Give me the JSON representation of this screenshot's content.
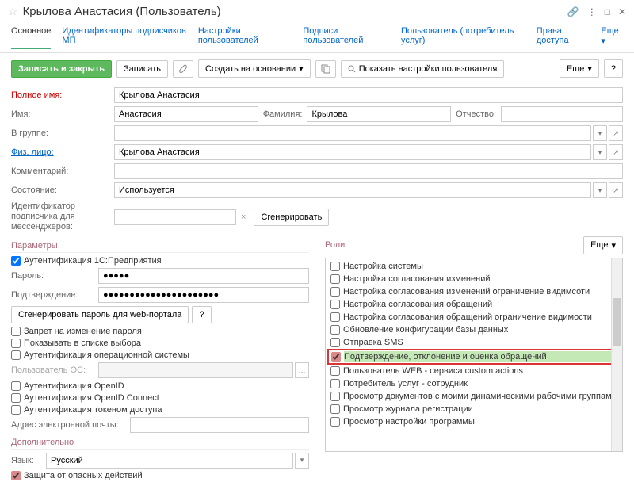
{
  "header": {
    "title": "Крылова Анастасия (Пользователь)"
  },
  "tabs": {
    "main": "Основное",
    "t1": "Идентификаторы подписчиков МП",
    "t2": "Настройки пользователей",
    "t3": "Подписи пользователей",
    "t4": "Пользователь (потребитель услуг)",
    "t5": "Права доступа",
    "more": "Еще"
  },
  "toolbar": {
    "save_close": "Записать и закрыть",
    "save": "Записать",
    "create_from": "Создать на основании",
    "show_settings": "Показать настройки пользователя",
    "more": "Еще",
    "help": "?"
  },
  "form": {
    "full_name_label": "Полное имя:",
    "full_name": "Крылова Анастасия",
    "name_label": "Имя:",
    "name": "Анастасия",
    "surname_label": "Фамилия:",
    "surname": "Крылова",
    "patronymic_label": "Отчество:",
    "patronymic": "",
    "group_label": "В группе:",
    "group": "",
    "person_label": "Физ. лицо:",
    "person": "Крылова Анастасия",
    "comment_label": "Комментарий:",
    "comment": "",
    "state_label": "Состояние:",
    "state": "Используется",
    "messenger_id_label": "Идентификатор подписчика для мессенджеров:",
    "messenger_id": "",
    "generate": "Сгенерировать"
  },
  "params": {
    "title": "Параметры",
    "auth_1c": "Аутентификация 1С:Предприятия",
    "password_label": "Пароль:",
    "password": "●●●●●",
    "confirm_label": "Подтверждение:",
    "confirm": "●●●●●●●●●●●●●●●●●●●●●●",
    "gen_web": "Сгенерировать пароль для web-портала",
    "help_q": "?",
    "no_change_pwd": "Запрет на изменение пароля",
    "show_in_list": "Показывать в списке выбора",
    "auth_os": "Аутентификация операционной системы",
    "os_user_label": "Пользователь ОС:",
    "os_user": "",
    "auth_openid": "Аутентификация OpenID",
    "auth_openid_connect": "Аутентификация OpenID Connect",
    "auth_token": "Аутентификация токеном доступа",
    "email_label": "Адрес электронной почты:",
    "email": ""
  },
  "extra": {
    "title": "Дополнительно",
    "lang_label": "Язык:",
    "lang": "Русский",
    "safe_actions": "Защита от опасных действий"
  },
  "roles": {
    "title": "Роли",
    "more": "Еще",
    "items": [
      {
        "label": "Настройка системы",
        "checked": false
      },
      {
        "label": "Настройка согласования изменений",
        "checked": false
      },
      {
        "label": "Настройка согласования изменений ограничение видимсоти",
        "checked": false
      },
      {
        "label": "Настройка согласования обращений",
        "checked": false
      },
      {
        "label": "Настройка согласования обращений ограничение видимости",
        "checked": false
      },
      {
        "label": "Обновление конфигурации базы данных",
        "checked": false
      },
      {
        "label": "Отправка SMS",
        "checked": false
      },
      {
        "label": "Подтверждение, отклонение и оценка обращений",
        "checked": true,
        "hl": true
      },
      {
        "label": "Пользователь WEB - сервиса custom actions",
        "checked": false
      },
      {
        "label": "Потребитель услуг - сотрудник",
        "checked": false
      },
      {
        "label": "Просмотр документов с моими динамическими рабочими группами",
        "checked": false
      },
      {
        "label": "Просмотр журнала регистрации",
        "checked": false
      },
      {
        "label": "Просмотр настройки программы",
        "checked": false
      }
    ]
  }
}
